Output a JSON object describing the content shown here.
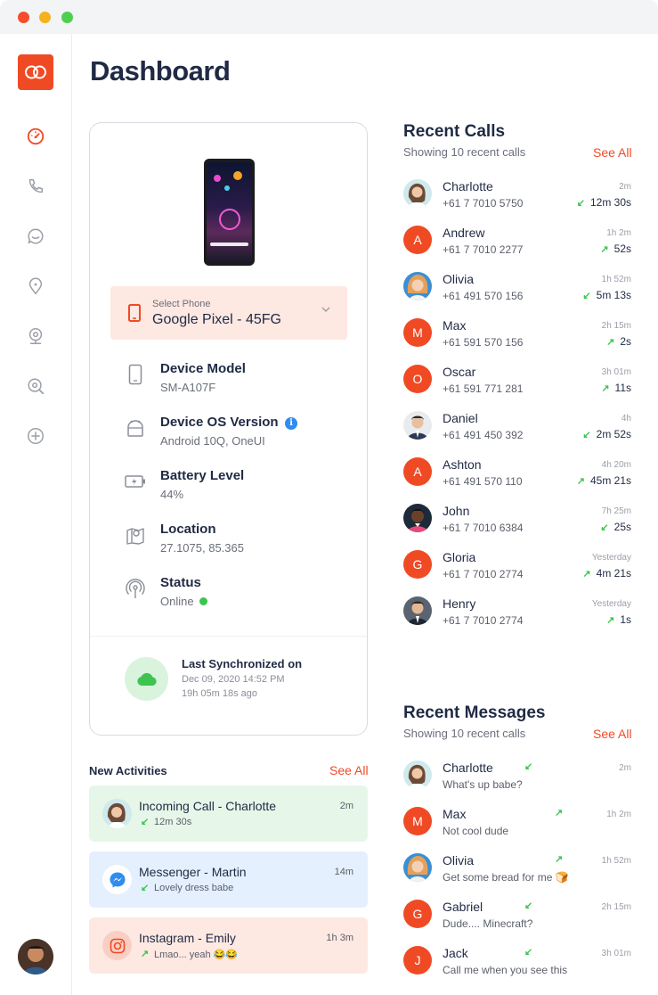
{
  "window": {
    "controls": [
      "close",
      "minimize",
      "maximize"
    ]
  },
  "sidebar": {
    "logo": "link-logo-icon",
    "items": [
      {
        "icon": "speedometer-icon",
        "active": true
      },
      {
        "icon": "phone-icon",
        "active": false
      },
      {
        "icon": "chat-icon",
        "active": false
      },
      {
        "icon": "location-pin-icon",
        "active": false
      },
      {
        "icon": "webcam-icon",
        "active": false
      },
      {
        "icon": "search-zoom-icon",
        "active": false
      },
      {
        "icon": "plus-circle-icon",
        "active": false
      }
    ],
    "accent_color": "#f04a25",
    "inactive_color": "#9a9ea8"
  },
  "page": {
    "title": "Dashboard"
  },
  "device": {
    "select_caption": "Select Phone",
    "select_value": "Google Pixel - 45FG",
    "info": [
      {
        "icon": "phone-outline-icon",
        "label": "Device Model",
        "value": "SM-A107F"
      },
      {
        "icon": "android-icon",
        "label": "Device OS Version",
        "value": "Android 10Q, OneUI",
        "badge": "i"
      },
      {
        "icon": "battery-charging-icon",
        "label": "Battery Level",
        "value": "44%"
      },
      {
        "icon": "map-pin-icon",
        "label": "Location",
        "value": "27.1075, 85.365"
      },
      {
        "icon": "broadcast-icon",
        "label": "Status",
        "value": "Online"
      }
    ],
    "sync": {
      "title": "Last Synchronized on",
      "date": "Dec 09, 2020 14:52 PM",
      "ago": "19h 05m 18s ago"
    }
  },
  "activities": {
    "title": "New Activities",
    "see_all": "See All",
    "items": [
      {
        "title": "Incoming Call - Charlotte",
        "sub": "12m 30s",
        "time": "2m",
        "arrow": "↙",
        "tone": "green"
      },
      {
        "title": "Messenger - Martin",
        "sub": "Lovely dress babe",
        "time": "14m",
        "arrow": "↙",
        "tone": "blue"
      },
      {
        "title": "Instagram -  Emily",
        "sub": "Lmao... yeah 😂😂",
        "time": "1h 3m",
        "arrow": "↗",
        "tone": "pink"
      }
    ]
  },
  "calls": {
    "title": "Recent Calls",
    "subtitle": "Showing 10 recent calls",
    "see_all": "See All",
    "items": [
      {
        "name": "Charlotte",
        "number": "+61 7 7010 5750",
        "time": "2m",
        "duration": "12m 30s",
        "arrow": "↙",
        "avatar": "photo"
      },
      {
        "name": "Andrew",
        "number": "+61 7 7010 2277",
        "time": "1h 2m",
        "duration": "52s",
        "arrow": "↗",
        "avatar": "A"
      },
      {
        "name": "Olivia",
        "number": "+61 491 570 156",
        "time": "1h 52m",
        "duration": "5m 13s",
        "arrow": "↙",
        "avatar": "photo"
      },
      {
        "name": "Max",
        "number": "+61 591 570 156",
        "time": "2h 15m",
        "duration": "2s",
        "arrow": "↗",
        "avatar": "M"
      },
      {
        "name": "Oscar",
        "number": "+61 591 771 281",
        "time": "3h 01m",
        "duration": "11s",
        "arrow": "↗",
        "avatar": "O"
      },
      {
        "name": "Daniel",
        "number": "+61 491 450 392",
        "time": "4h",
        "duration": "2m 52s",
        "arrow": "↙",
        "avatar": "photo"
      },
      {
        "name": "Ashton",
        "number": "+61 491 570 110",
        "time": "4h 20m",
        "duration": "45m 21s",
        "arrow": "↗",
        "avatar": "A"
      },
      {
        "name": "John",
        "number": "+61 7 7010 6384",
        "time": "7h 25m",
        "duration": "25s",
        "arrow": "↙",
        "avatar": "photo"
      },
      {
        "name": "Gloria",
        "number": "+61 7 7010 2774",
        "time": "Yesterday",
        "duration": "4m 21s",
        "arrow": "↗",
        "avatar": "G"
      },
      {
        "name": "Henry",
        "number": "+61 7 7010 2774",
        "time": "Yesterday",
        "duration": "1s",
        "arrow": "↗",
        "avatar": "photo"
      }
    ]
  },
  "messages": {
    "title": "Recent Messages",
    "subtitle": "Showing 10 recent calls",
    "see_all": "See All",
    "items": [
      {
        "name": "Charlotte",
        "text": "What's up babe?",
        "time": "2m",
        "arrow": "↙",
        "avatar": "photo"
      },
      {
        "name": "Max",
        "text": "Not cool dude",
        "time": "1h 2m",
        "arrow": "↗",
        "avatar": "M"
      },
      {
        "name": "Olivia",
        "text": "Get some bread for me 🍞",
        "time": "1h 52m",
        "arrow": "↗",
        "avatar": "photo"
      },
      {
        "name": "Gabriel",
        "text": "Dude.... Minecraft?",
        "time": "2h 15m",
        "arrow": "↙",
        "avatar": "G"
      },
      {
        "name": "Jack",
        "text": "Call me when you see this",
        "time": "3h 01m",
        "arrow": "↙",
        "avatar": "J"
      }
    ]
  }
}
